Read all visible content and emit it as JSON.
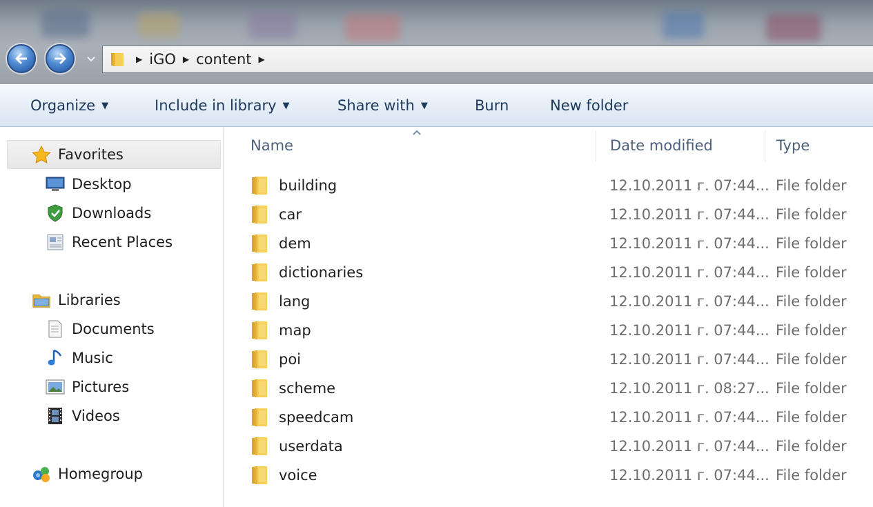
{
  "address": {
    "crumbs": [
      "iGO",
      "content"
    ]
  },
  "toolbar": {
    "organize": "Organize",
    "include_in_library": "Include in library",
    "share_with": "Share with",
    "burn": "Burn",
    "new_folder": "New folder"
  },
  "nav": {
    "favorites": "Favorites",
    "desktop": "Desktop",
    "downloads": "Downloads",
    "recent_places": "Recent Places",
    "libraries": "Libraries",
    "documents": "Documents",
    "music": "Music",
    "pictures": "Pictures",
    "videos": "Videos",
    "homegroup": "Homegroup"
  },
  "columns": {
    "name": "Name",
    "date_modified": "Date modified",
    "type": "Type"
  },
  "files": [
    {
      "name": "building",
      "date": "12.10.2011 г. 07:44...",
      "type": "File folder"
    },
    {
      "name": "car",
      "date": "12.10.2011 г. 07:44...",
      "type": "File folder"
    },
    {
      "name": "dem",
      "date": "12.10.2011 г. 07:44...",
      "type": "File folder"
    },
    {
      "name": "dictionaries",
      "date": "12.10.2011 г. 07:44...",
      "type": "File folder"
    },
    {
      "name": "lang",
      "date": "12.10.2011 г. 07:44...",
      "type": "File folder"
    },
    {
      "name": "map",
      "date": "12.10.2011 г. 07:44...",
      "type": "File folder"
    },
    {
      "name": "poi",
      "date": "12.10.2011 г. 07:44...",
      "type": "File folder"
    },
    {
      "name": "scheme",
      "date": "12.10.2011 г. 08:27...",
      "type": "File folder"
    },
    {
      "name": "speedcam",
      "date": "12.10.2011 г. 07:44...",
      "type": "File folder"
    },
    {
      "name": "userdata",
      "date": "12.10.2011 г. 07:44...",
      "type": "File folder"
    },
    {
      "name": "voice",
      "date": "12.10.2011 г. 07:44...",
      "type": "File folder"
    }
  ],
  "icons": {
    "folder": "folder-icon",
    "favorites": "star-icon",
    "desktop": "desktop-icon",
    "downloads": "downloads-icon",
    "recent_places": "recent-places-icon",
    "libraries": "libraries-icon",
    "documents": "documents-icon",
    "music": "music-icon",
    "pictures": "pictures-icon",
    "videos": "videos-icon",
    "homegroup": "homegroup-icon"
  },
  "colors": {
    "accent_text": "#1e395b",
    "folder_yellow": "#f3c64a",
    "secondary_text": "#6d6d6d"
  }
}
